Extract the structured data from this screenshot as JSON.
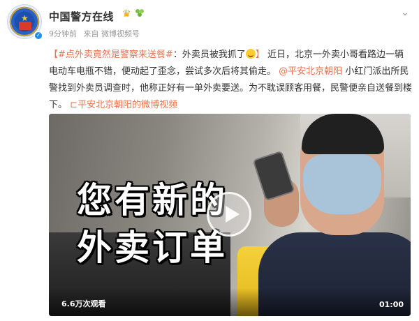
{
  "post": {
    "user_name": "中国警方在线",
    "time_ago": "9分钟前",
    "source": "来自 微博视频号",
    "text": {
      "bracket_open": "【",
      "topic": "#点外卖竟然是警察来送餐#",
      "colon_text": "：外卖员被我抓了",
      "bracket_close": "】",
      "body1": "近日，北京一外卖小哥看路边一辆电动车电瓶不错，便动起了歪念，尝试多次后将其偷走。",
      "mention": "@平安北京朝阳",
      "body2": "小红门派出所民警找到外卖员调查时，他称正好有一单外卖要送。为不耽误顾客用餐，民警便亲自送餐到楼下。",
      "video_link": "平安北京朝阳的微博视频"
    }
  },
  "video": {
    "overlay_line1": "您有新的",
    "overlay_line2": "外卖订单",
    "views": "6.6万次观看",
    "duration": "01:00"
  },
  "icons": {
    "menu": "chevron-down-icon",
    "crown": "crown-icon",
    "leaf": "leaf-icon",
    "verified": "verified-icon",
    "play": "play-icon",
    "link": "video-link-icon"
  },
  "colors": {
    "accent": "#eb7350",
    "verified": "#1b8ff2"
  }
}
